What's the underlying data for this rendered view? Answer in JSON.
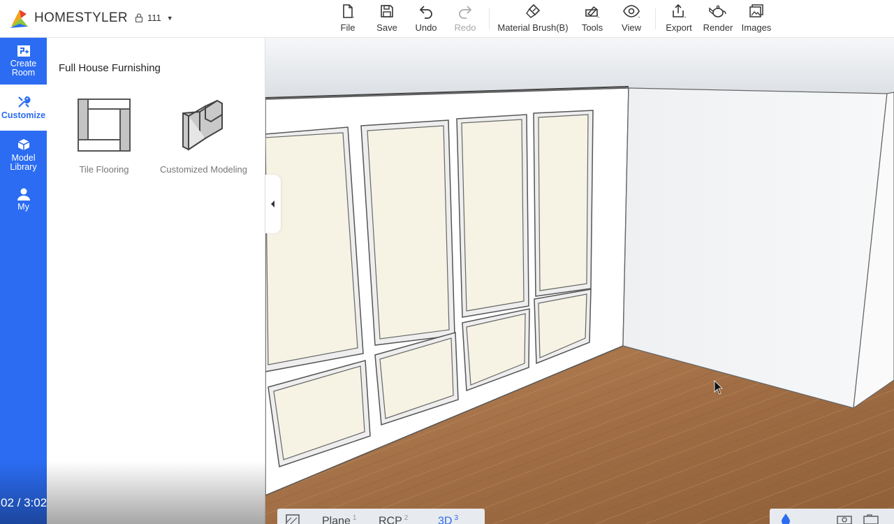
{
  "app": {
    "brand": "HOMESTYLER",
    "project_name": "111"
  },
  "toolbar": [
    {
      "label": "File",
      "icon": "file-icon"
    },
    {
      "label": "Save",
      "icon": "save-icon"
    },
    {
      "label": "Undo",
      "icon": "undo-icon"
    },
    {
      "label": "Redo",
      "icon": "redo-icon",
      "disabled": true
    },
    {
      "label": "Material Brush(B)",
      "icon": "brush-icon"
    },
    {
      "label": "Tools",
      "icon": "tools-icon"
    },
    {
      "label": "View",
      "icon": "eye-icon"
    },
    {
      "label": "Export",
      "icon": "export-icon"
    },
    {
      "label": "Render",
      "icon": "teapot-icon"
    },
    {
      "label": "Images",
      "icon": "images-icon"
    }
  ],
  "sidebar": {
    "items": [
      {
        "label_line1": "Create",
        "label_line2": "Room",
        "icon": "create-room-icon"
      },
      {
        "label_line1": "Customize",
        "label_line2": "",
        "icon": "customize-icon",
        "active": true
      },
      {
        "label_line1": "Model",
        "label_line2": "Library",
        "icon": "model-library-icon"
      },
      {
        "label_line1": "My",
        "label_line2": "",
        "icon": "user-icon"
      }
    ]
  },
  "panel": {
    "title": "Full House Furnishing",
    "cards": [
      {
        "label": "Tile Flooring",
        "icon": "tile-flooring-icon"
      },
      {
        "label": "Customized Modeling",
        "icon": "customized-modeling-icon"
      }
    ]
  },
  "video": {
    "timecode": "02 / 3:02"
  },
  "view_tabs": [
    {
      "label": "Plane",
      "key": "1"
    },
    {
      "label": "RCP",
      "key": "2"
    },
    {
      "label": "3D",
      "key": "3",
      "active": true
    }
  ],
  "colors": {
    "accent": "#2b6cf2",
    "panel_fill": "#f6f3e4",
    "floor": "#a6744a"
  }
}
